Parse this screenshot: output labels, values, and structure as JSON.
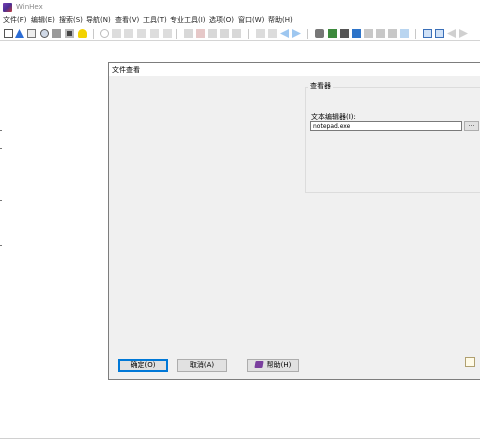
{
  "app": {
    "title": "WinHex"
  },
  "menu": [
    "文件(F)",
    "编辑(E)",
    "搜索(S)",
    "导航(N)",
    "查看(V)",
    "工具(T)",
    "专业工具(I)",
    "选项(O)",
    "窗口(W)",
    "帮助(H)"
  ],
  "toolbar_icons": [
    "new-file-icon",
    "open-file-icon",
    "save-icon",
    "save-all-icon",
    "print-icon",
    "properties-icon",
    "bulb-icon",
    "undo-icon",
    "copy-icon",
    "cut-icon",
    "paste-icon",
    "paste-block-icon",
    "paste-special-icon",
    "find-text-icon",
    "find-hex-icon",
    "replace-text-icon",
    "replace-hex-icon",
    "find-again-icon",
    "goto-offset-icon",
    "goto-page-icon",
    "back-icon",
    "forward-icon",
    "open-disk-icon",
    "open-ram-icon",
    "disk-clone-icon",
    "calculator-icon",
    "hash-icon",
    "binary-compare-icon",
    "analyze-icon",
    "edit-disk-icon",
    "ram-editor-icon",
    "options-icon",
    "case-data-icon",
    "ctrl-panel-icon",
    "sync-icon",
    "dir-browser-icon"
  ],
  "dialog": {
    "title": "文件查看",
    "group_title": "查看器",
    "editor_label": "文本编辑器(I):",
    "editor_value": "notepad.exe",
    "browse_label": "...",
    "ok_label": "确定(O)",
    "cancel_label": "取消(A)",
    "help_label": "帮助(H)"
  }
}
